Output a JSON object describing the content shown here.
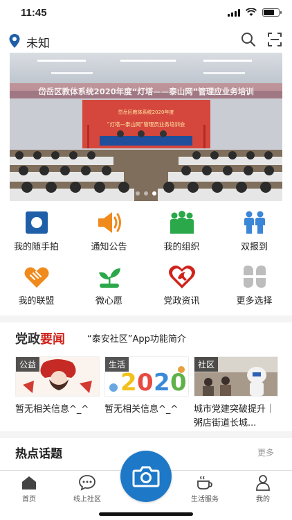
{
  "status": {
    "time": "11:45"
  },
  "header": {
    "location": "未知",
    "location_icon": "location-pin-icon",
    "search_icon": "search-icon",
    "scan_icon": "scan-icon"
  },
  "banner": {
    "caption_text": "岱岳区教体系统2020年度“灯塔——泰山网”管理应业务培训",
    "screen_line1": "岱岳区教体系统2020年度",
    "screen_line2": "“灯塔—泰山网”管理员业务培训会",
    "page_count": 3,
    "active_index": 2
  },
  "grid": [
    {
      "label": "我的随手拍",
      "icon": "camera-square-icon",
      "color": "#1f5fa8"
    },
    {
      "label": "通知公告",
      "icon": "speaker-icon",
      "color": "#f08a1c"
    },
    {
      "label": "我的组织",
      "icon": "group-icon",
      "color": "#2aa84a"
    },
    {
      "label": "双报到",
      "icon": "two-people-icon",
      "color": "#3b86d6"
    },
    {
      "label": "我的联盟",
      "icon": "handshake-heart-icon",
      "color": "#f08a1c"
    },
    {
      "label": "微心愿",
      "icon": "sprout-icon",
      "color": "#2aa84a"
    },
    {
      "label": "党政资讯",
      "icon": "party-heart-icon",
      "color": "#d0231b"
    },
    {
      "label": "更多选择",
      "icon": "more-grid-icon",
      "color": "#bbbbbb"
    }
  ],
  "news": {
    "brand_part1": "党政",
    "brand_part2": "要闻",
    "ticker": "“泰安社区”App功能简介",
    "cards": [
      {
        "tag": "公益",
        "title": "暂无相关信息^_^"
      },
      {
        "tag": "生活",
        "title": "暂无相关信息^_^"
      },
      {
        "tag": "社区",
        "title": "城市党建突破提升｜粥店街道长城..."
      }
    ]
  },
  "hot": {
    "title": "热点话题",
    "more": "更多"
  },
  "tabbar": {
    "items": [
      {
        "label": "首页",
        "icon": "home-icon"
      },
      {
        "label": "线上社区",
        "icon": "chat-icon"
      },
      {
        "label": "生活服务",
        "icon": "coffee-icon"
      },
      {
        "label": "我的",
        "icon": "user-icon"
      }
    ],
    "camera_icon": "camera-icon",
    "accent": "#1d78c8"
  }
}
